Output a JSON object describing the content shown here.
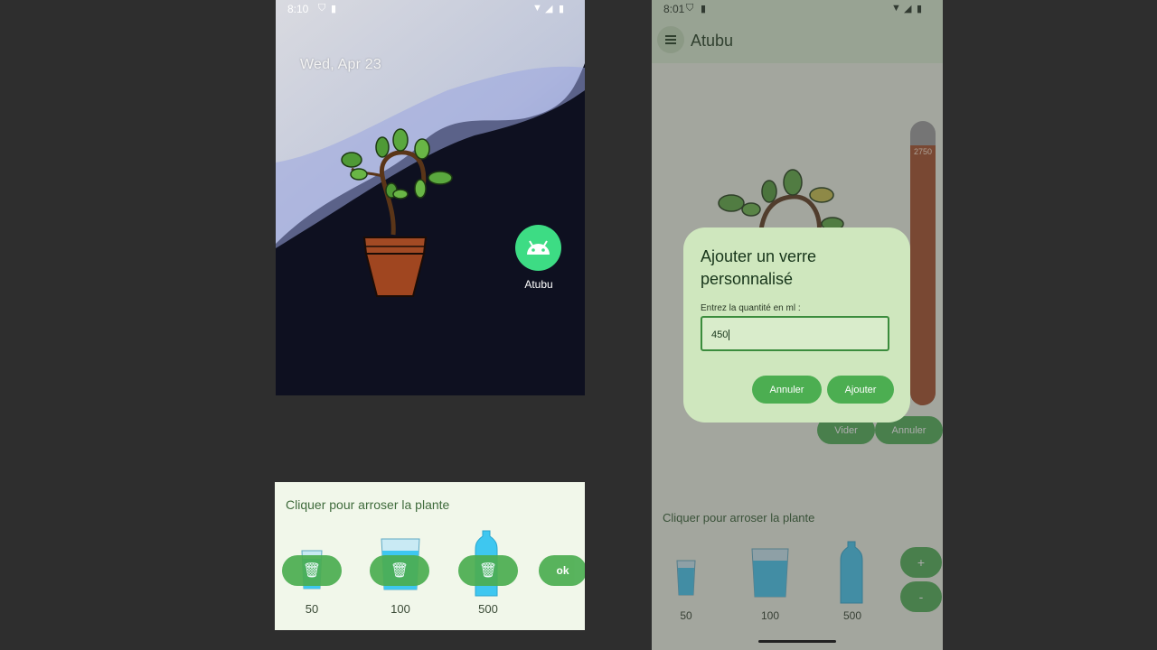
{
  "left_phone": {
    "status": {
      "time": "8:10"
    },
    "date": "Wed, Apr 23",
    "app": {
      "label": "Atubu"
    }
  },
  "sheet": {
    "title": "Cliquer pour arroser la plante",
    "volumes": [
      "50",
      "100",
      "500"
    ],
    "ok_label": "ok"
  },
  "right_phone": {
    "status": {
      "time": "8:01"
    },
    "app_title": "Atubu",
    "gauge_value": "2750",
    "background_buttons": {
      "vider": "Vider",
      "annuler": "Annuler"
    },
    "section_title": "Cliquer pour arroser la plante",
    "volumes": [
      "50",
      "100",
      "500"
    ],
    "plus": "+",
    "minus": "-"
  },
  "dialog": {
    "title": "Ajouter un verre personnalisé",
    "prompt": "Entrez la quantité en ml :",
    "input_value": "450",
    "cancel_label": "Annuler",
    "add_label": "Ajouter"
  },
  "colors": {
    "accent": "#4cae51",
    "soil": "#a24a24",
    "dialog": "#cfe7be"
  }
}
